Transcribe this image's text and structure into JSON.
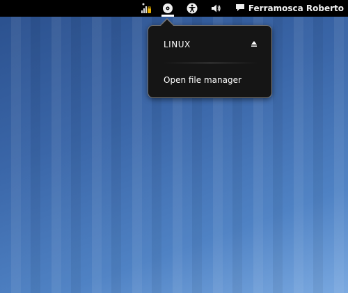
{
  "topbar": {
    "user_name": "Ferramosca Roberto",
    "icons": [
      "network-signal-icon",
      "removable-devices-icon",
      "accessibility-icon",
      "volume-icon",
      "chat-status-icon"
    ]
  },
  "devices_menu": {
    "device_name": "LINUX",
    "eject_icon": "eject-icon",
    "open_file_manager_label": "Open file manager"
  },
  "colors": {
    "topbar_bg": "#000000",
    "popup_bg": "#151515",
    "popup_border": "#7a7a7a",
    "desktop_top": "#2a4f8c",
    "desktop_bottom": "#79a8e0"
  }
}
